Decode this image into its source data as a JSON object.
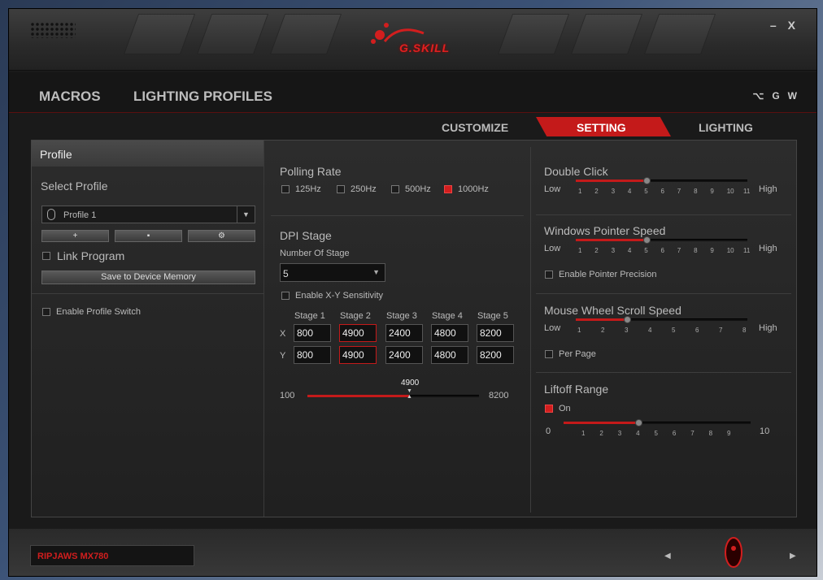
{
  "window": {
    "brand": "G.SKILL",
    "minimize": "–",
    "close": "X"
  },
  "nav": {
    "macros": "MACROS",
    "lighting_profiles": "LIGHTING PROFILES",
    "right_icons": [
      "G",
      "W"
    ]
  },
  "subtabs": {
    "customize": "CUSTOMIZE",
    "setting": "SETTING",
    "lighting": "LIGHTING"
  },
  "left": {
    "header": "Profile",
    "select_profile": "Select Profile",
    "profile_value": "Profile 1",
    "link_program": "Link Program",
    "save_button": "Save to Device Memory",
    "enable_profile_switch": "Enable Profile Switch"
  },
  "polling": {
    "title": "Polling Rate",
    "options": [
      "125Hz",
      "250Hz",
      "500Hz",
      "1000Hz"
    ],
    "selected": "1000Hz"
  },
  "dpi": {
    "title": "DPI Stage",
    "number_of_stage_label": "Number Of Stage",
    "number_of_stage": "5",
    "xy_sensitivity": "Enable X-Y Sensitivity",
    "stages": [
      "Stage 1",
      "Stage 2",
      "Stage 3",
      "Stage 4",
      "Stage 5"
    ],
    "x_label": "X",
    "y_label": "Y",
    "x_values": [
      "800",
      "4900",
      "2400",
      "4800",
      "8200"
    ],
    "y_values": [
      "800",
      "4900",
      "2400",
      "4800",
      "8200"
    ],
    "slider_min": "100",
    "slider_max": "8200",
    "slider_value": "4900"
  },
  "double_click": {
    "title": "Double Click",
    "low": "Low",
    "high": "High",
    "ticks": [
      "1",
      "2",
      "3",
      "4",
      "5",
      "6",
      "7",
      "8",
      "9",
      "10",
      "11"
    ],
    "value": 5
  },
  "pointer_speed": {
    "title": "Windows Pointer Speed",
    "low": "Low",
    "high": "High",
    "ticks": [
      "1",
      "2",
      "3",
      "4",
      "5",
      "6",
      "7",
      "8",
      "9",
      "10",
      "11"
    ],
    "value": 5,
    "precision": "Enable Pointer Precision"
  },
  "scroll_speed": {
    "title": "Mouse Wheel Scroll Speed",
    "low": "Low",
    "high": "High",
    "ticks": [
      "1",
      "2",
      "3",
      "4",
      "5",
      "6",
      "7",
      "8"
    ],
    "value": 3,
    "per_page": "Per Page"
  },
  "liftoff": {
    "title": "Liftoff Range",
    "on_label": "On",
    "min": "0",
    "max": "10",
    "ticks": [
      "1",
      "2",
      "3",
      "4",
      "5",
      "6",
      "7",
      "8",
      "9"
    ],
    "value": 4
  },
  "footer": {
    "model": "RIPJAWS MX780"
  }
}
